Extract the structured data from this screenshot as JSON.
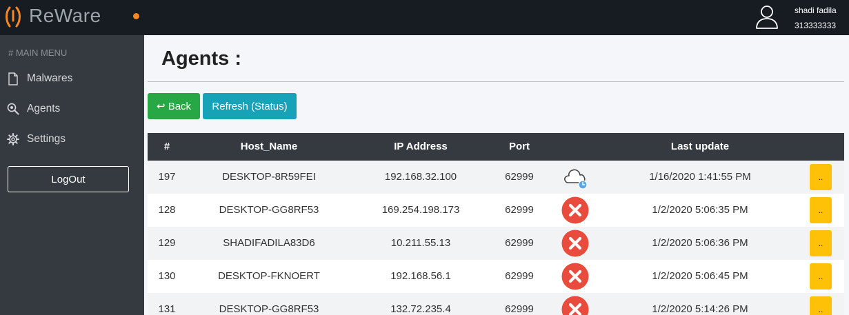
{
  "app": {
    "name": "ReWare",
    "accent": "#f5891f"
  },
  "user": {
    "name": "shadi fadila",
    "id": "313333333"
  },
  "sidebar": {
    "header": "# MAIN MENU",
    "items": [
      {
        "label": "Malwares",
        "icon": "file-icon"
      },
      {
        "label": "Agents",
        "icon": "search-icon"
      },
      {
        "label": "Settings",
        "icon": "gear-icon"
      }
    ],
    "logout": "LogOut"
  },
  "main": {
    "title": "Agents :",
    "back_label": "↩ Back",
    "refresh_label": "Refresh (Status)"
  },
  "table": {
    "headers": [
      "#",
      "Host_Name",
      "IP Address",
      "Port",
      "",
      "Last update",
      ""
    ],
    "rows": [
      {
        "id": "197",
        "host": "DESKTOP-8R59FEI",
        "ip": "192.168.32.100",
        "port": "62999",
        "status": "cloud-pending",
        "last": "1/16/2020 1:41:55 PM",
        "action": ".."
      },
      {
        "id": "128",
        "host": "DESKTOP-GG8RF53",
        "ip": "169.254.198.173",
        "port": "62999",
        "status": "offline",
        "last": "1/2/2020 5:06:35 PM",
        "action": ".."
      },
      {
        "id": "129",
        "host": "SHADIFADILA83D6",
        "ip": "10.211.55.13",
        "port": "62999",
        "status": "offline",
        "last": "1/2/2020 5:06:36 PM",
        "action": ".."
      },
      {
        "id": "130",
        "host": "DESKTOP-FKNOERT",
        "ip": "192.168.56.1",
        "port": "62999",
        "status": "offline",
        "last": "1/2/2020 5:06:45 PM",
        "action": ".."
      },
      {
        "id": "131",
        "host": "DESKTOP-GG8RF53",
        "ip": "132.72.235.4",
        "port": "62999",
        "status": "offline",
        "last": "1/2/2020 5:14:26 PM",
        "action": ".."
      }
    ]
  },
  "colors": {
    "back": "#28a745",
    "refresh": "#17a2b8",
    "action": "#ffc107",
    "offline": "#e94b3c"
  }
}
